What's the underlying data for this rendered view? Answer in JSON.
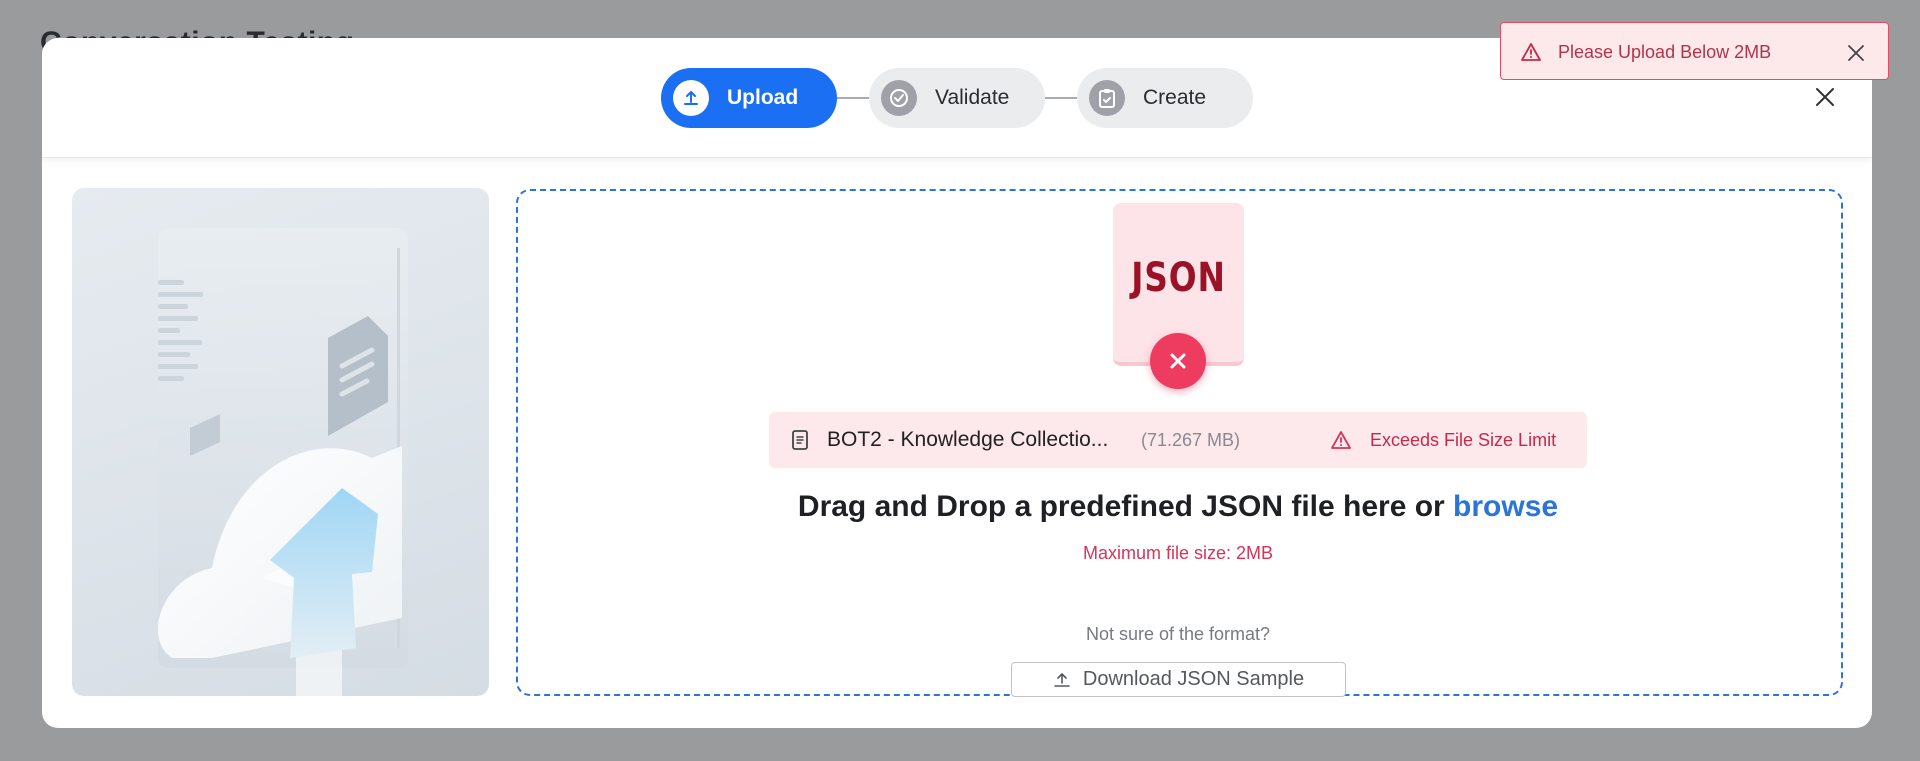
{
  "background": {
    "title": "Conversation Testing"
  },
  "stepper": {
    "steps": [
      {
        "label": "Upload",
        "icon": "upload-icon",
        "state": "active"
      },
      {
        "label": "Validate",
        "icon": "check-circle-icon",
        "state": "inactive"
      },
      {
        "label": "Create",
        "icon": "clipboard-check-icon",
        "state": "inactive"
      }
    ]
  },
  "dropzone": {
    "file_icon": "JSON",
    "file": {
      "name": "BOT2 - Knowledge Collectio...",
      "size": "(71.267 MB)",
      "error": "Exceeds File Size Limit"
    },
    "headline_prefix": "Drag and Drop a predefined JSON file here or ",
    "browse_label": "browse",
    "max_size": "Maximum file size: 2MB",
    "format_hint": "Not sure of the format?",
    "download_label": "Download JSON Sample"
  },
  "toast": {
    "message": "Please Upload Below 2MB"
  },
  "colors": {
    "primary": "#1a6ff2",
    "error": "#d6345a",
    "error_bg": "#fde8eb",
    "overlay": "#9a9b9d"
  }
}
